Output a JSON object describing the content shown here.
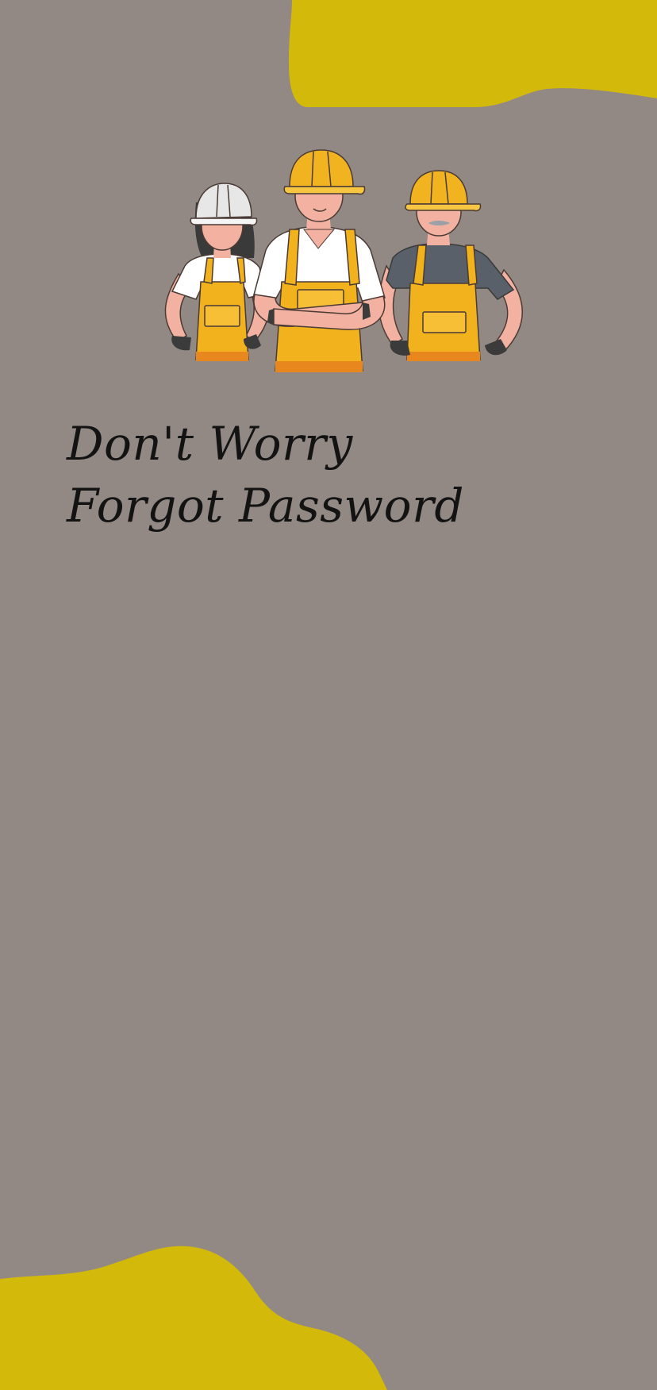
{
  "screen": {
    "title_line1": "Don't Worry",
    "title_line2": "Forgot Password"
  },
  "colors": {
    "background": "#928984",
    "accent_blob": "#D3B90A",
    "title_text": "#131313",
    "overall_yellow": "#F1B21E",
    "helmet_yellow": "#F2B320",
    "helmet_white": "#E7E7E7",
    "shirt_gray": "#59606A"
  },
  "illustration": {
    "icon": "construction-workers-illustration"
  }
}
